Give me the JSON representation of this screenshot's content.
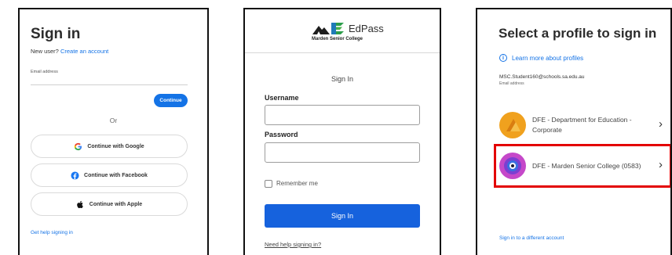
{
  "panel1": {
    "title": "Sign in",
    "new_user_prefix": "New user?",
    "create_account_link": "Create an account",
    "email_label": "Email address",
    "continue_button": "Continue",
    "or_divider": "Or",
    "google_button": "Continue with Google",
    "facebook_button": "Continue with Facebook",
    "apple_button": "Continue with Apple",
    "help_link": "Get help signing in"
  },
  "panel2": {
    "logo_text": "EdPass",
    "logo_subtitle": "Marden Senior College",
    "signin_title": "Sign In",
    "username_label": "Username",
    "password_label": "Password",
    "remember_label": "Remember me",
    "signin_button": "Sign In",
    "help_link": "Need help signing in?"
  },
  "panel3": {
    "title": "Select a profile to sign in",
    "learn_more": "Learn more about profiles",
    "email": "MSC.Student160@schools.sa.edu.au",
    "email_caption": "Email address",
    "profiles": [
      {
        "label": "DFE - Department for Education - Corporate",
        "icon": "orange-triangle-avatar"
      },
      {
        "label": "DFE - Marden Senior College (0583)",
        "icon": "purple-badge-avatar"
      }
    ],
    "other_account_link": "Sign in to a different account"
  },
  "colors": {
    "accent_blue": "#1473e6",
    "edpass_button": "#1662dd",
    "highlight_red": "#e30000"
  }
}
